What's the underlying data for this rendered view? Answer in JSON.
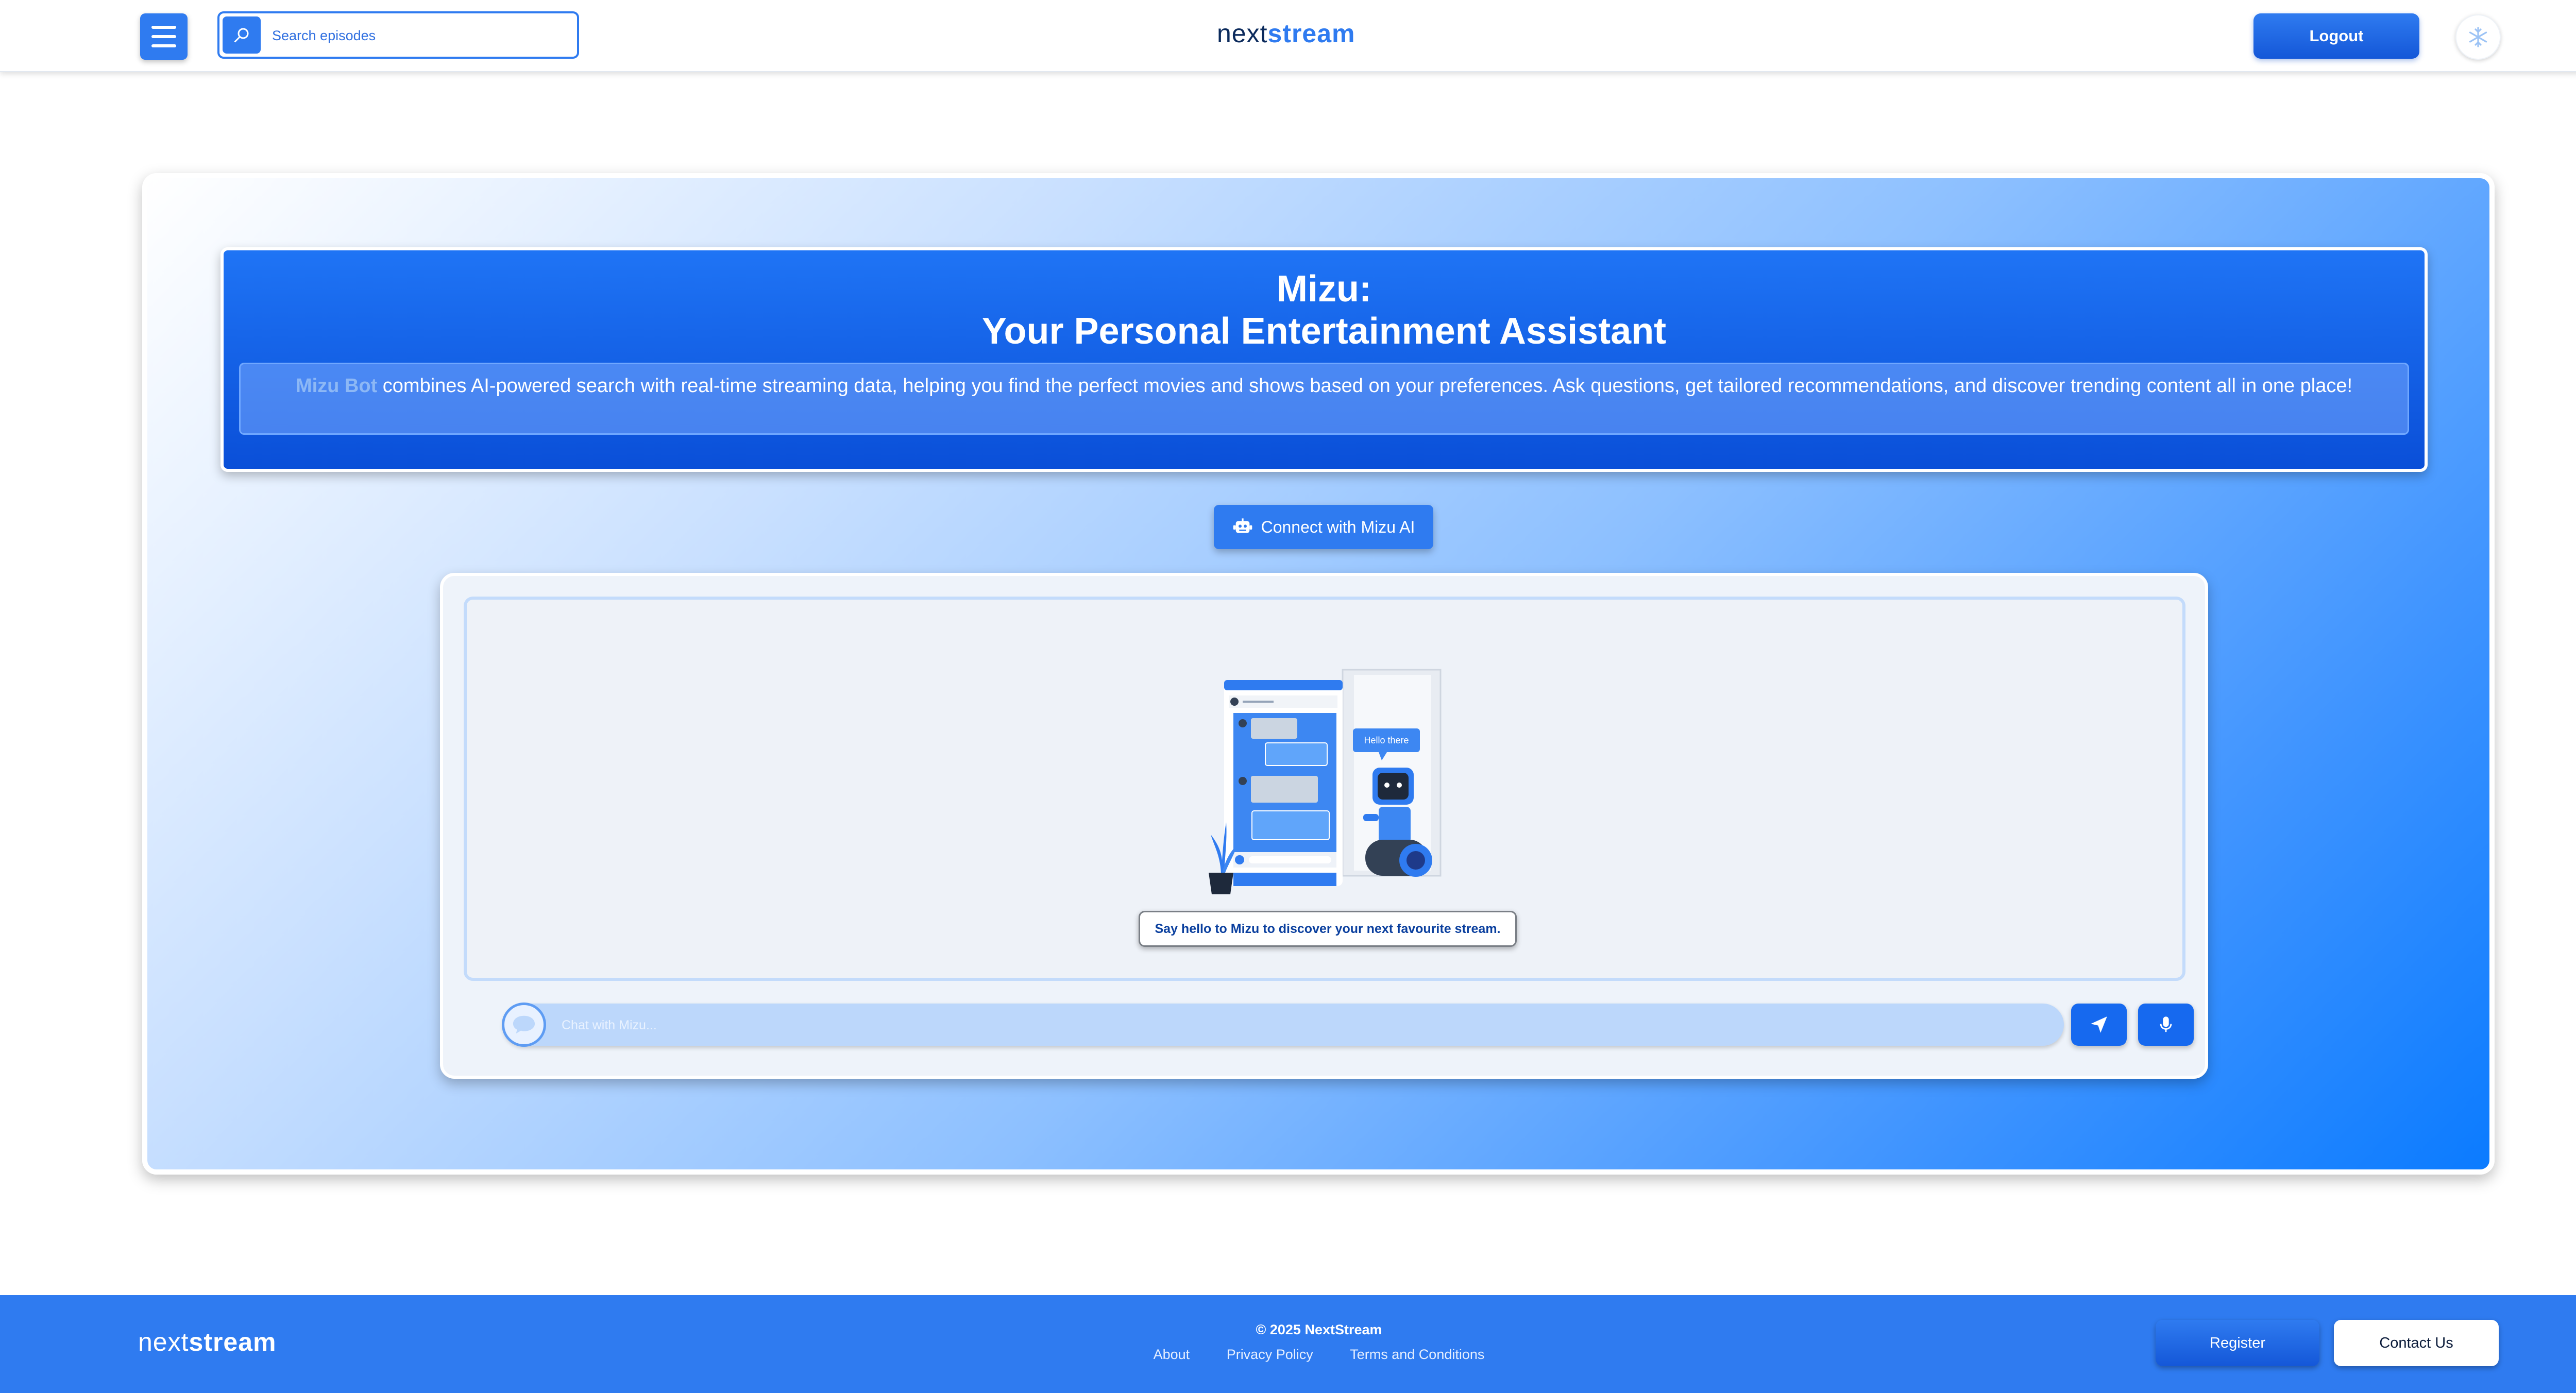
{
  "header": {
    "search_placeholder": "Search episodes",
    "brand_light": "next",
    "brand_bold": "stream",
    "logout_label": "Logout"
  },
  "hero": {
    "title_line1": "Mizu:",
    "title_line2": "Your Personal Entertainment Assistant",
    "bot_name": "Mizu Bot",
    "description": " combines AI-powered search with real-time streaming data, helping you find the perfect movies and shows based on your preferences. Ask questions, get tailored recommendations, and discover trending content all in one place!",
    "connect_label": "Connect with Mizu AI"
  },
  "chat": {
    "illustration_bubble": "Hello there",
    "welcome_text": "Say hello to Mizu to discover your next favourite stream.",
    "input_placeholder": "Chat with Mizu..."
  },
  "footer": {
    "brand_light": "next",
    "brand_bold": "stream",
    "copyright": "© 2025 NextStream",
    "links": [
      "About",
      "Privacy Policy",
      "Terms and Conditions"
    ],
    "register_label": "Register",
    "contact_label": "Contact Us"
  },
  "colors": {
    "primary": "#2f7bf0",
    "primary_dark": "#1457d8",
    "navy": "#0b2a5c"
  },
  "icons": [
    "menu-icon",
    "search-icon",
    "snowflake-icon",
    "robot-icon",
    "chat-bubble-icon",
    "send-icon",
    "microphone-icon"
  ]
}
